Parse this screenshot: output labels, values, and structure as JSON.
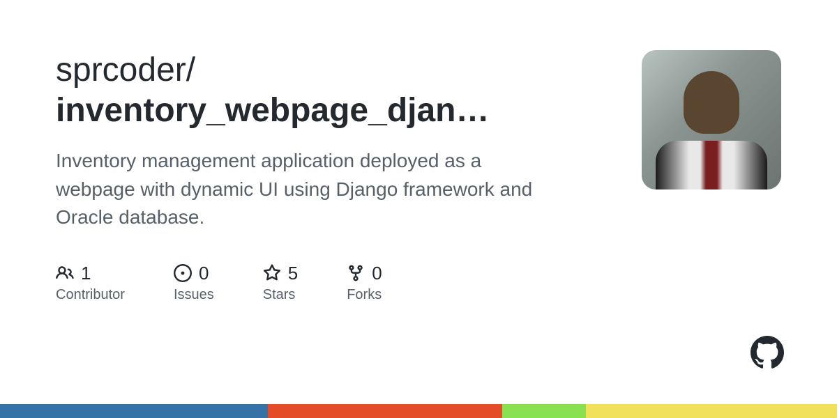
{
  "repo": {
    "owner": "sprcoder",
    "slash": "/",
    "name": "inventory_webpage_djan…"
  },
  "description": "Inventory management application deployed as a webpage with dynamic UI using Django framework and Oracle database.",
  "stats": {
    "contributors": {
      "value": "1",
      "label": "Contributor"
    },
    "issues": {
      "value": "0",
      "label": "Issues"
    },
    "stars": {
      "value": "5",
      "label": "Stars"
    },
    "forks": {
      "value": "0",
      "label": "Forks"
    }
  },
  "color_bar": [
    {
      "color": "#3572A5",
      "width": "32%"
    },
    {
      "color": "#e34c26",
      "width": "28%"
    },
    {
      "color": "#89e051",
      "width": "10%"
    },
    {
      "color": "#f1e05a",
      "width": "30%"
    }
  ]
}
